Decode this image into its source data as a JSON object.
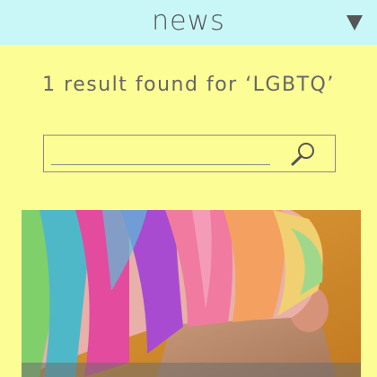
{
  "header": {
    "title": "news",
    "menu_icon": "triangle-down-icon"
  },
  "search": {
    "result_text": "1 result found for ‘LGBTQ’",
    "value": "",
    "placeholder": "",
    "button_icon": "search-icon"
  },
  "results": [
    {
      "image": "rainbow-hair-photo"
    }
  ]
}
